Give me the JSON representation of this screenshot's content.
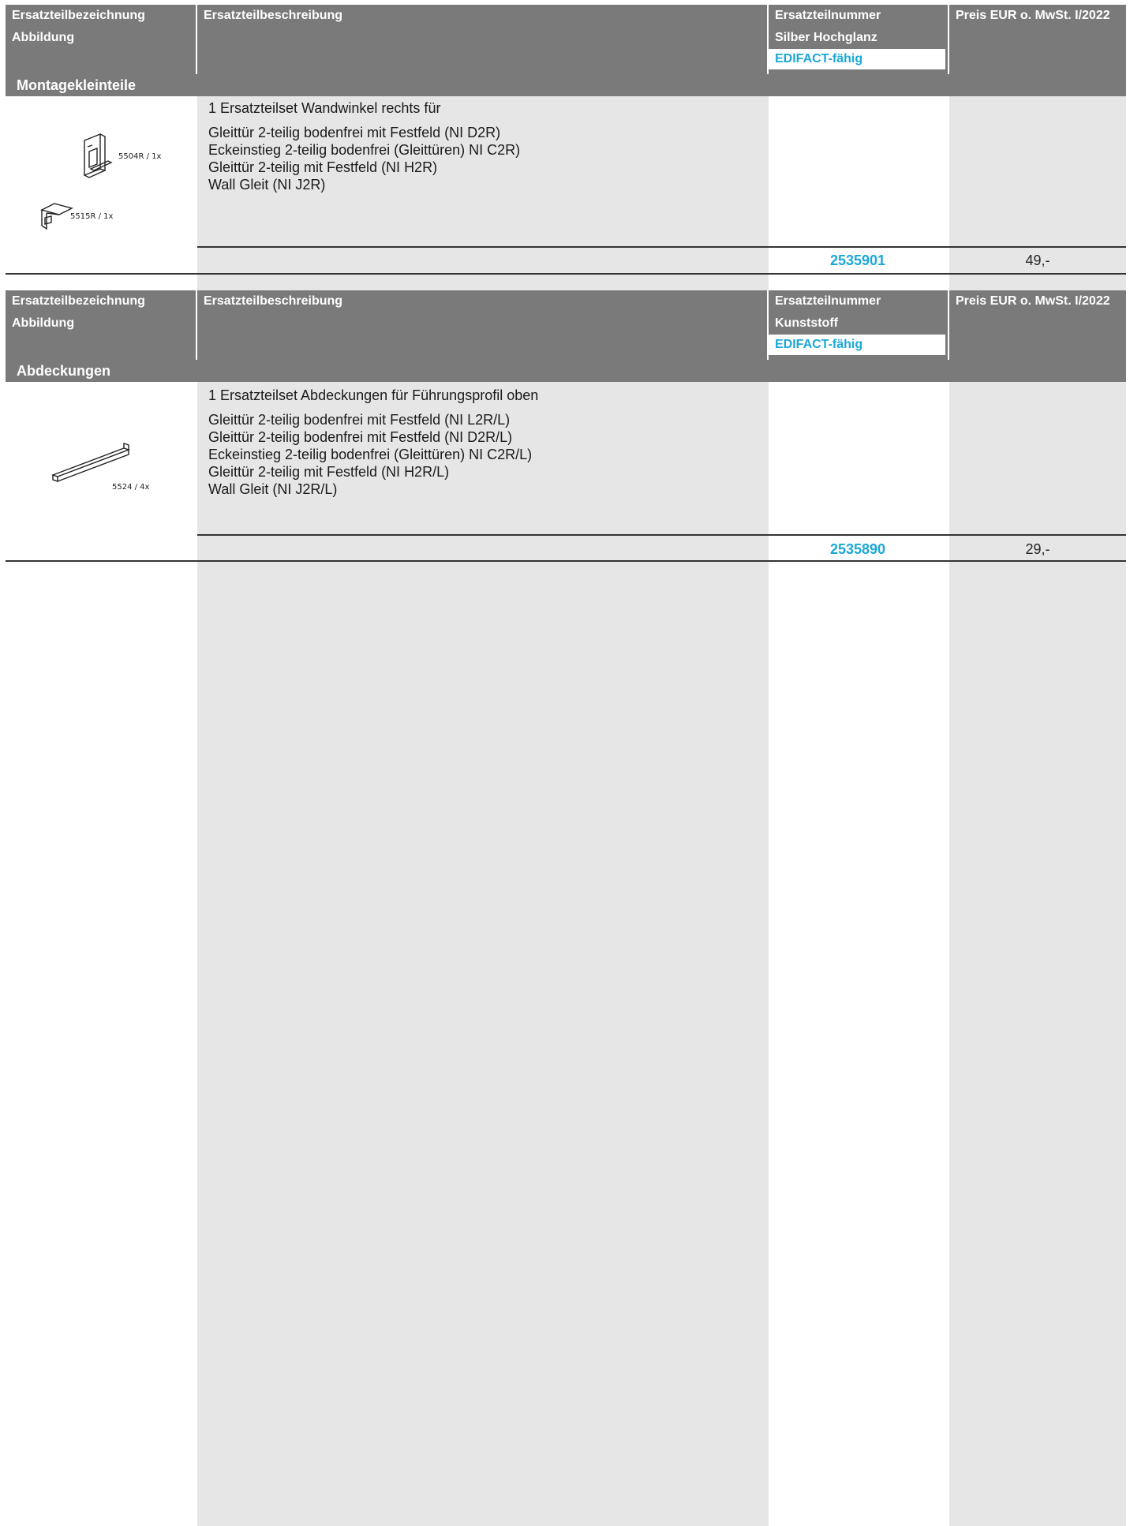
{
  "header": {
    "col1_line1": "Ersatzteilbezeichnung",
    "col1_line2": "Abbildung",
    "col2": "Ersatzteilbeschreibung",
    "col3_line1": "Ersatzteilnummer",
    "col3_edifact": "EDIFACT-fähig",
    "col4": "Preis EUR o. MwSt. I/2022"
  },
  "sections": [
    {
      "material": "Silber Hochglanz",
      "title": "Montagekleinteile",
      "description_title": "1 Ersatzteilset Wandwinkel rechts für",
      "description_items": [
        "Gleittür 2-teilig bodenfrei mit Festfeld (NI D2R)",
        "Eckeinstieg 2-teilig bodenfrei (Gleittüren) NI C2R)",
        "Gleittür 2-teilig mit Festfeld (NI H2R)",
        "Wall Gleit (NI J2R)"
      ],
      "image_labels": [
        "5504R / 1x",
        "5515R / 1x"
      ],
      "part_number": "2535901",
      "price": "49,-"
    },
    {
      "material": "Kunststoff",
      "title": "Abdeckungen",
      "description_title": "1 Ersatzteilset Abdeckungen für Führungsprofil oben",
      "description_items": [
        "Gleittür 2-teilig bodenfrei mit Festfeld (NI L2R/L)",
        "Gleittür 2-teilig bodenfrei mit Festfeld (NI D2R/L)",
        "Eckeinstieg 2-teilig bodenfrei (Gleittüren) NI C2R/L)",
        "Gleittür 2-teilig mit Festfeld (NI H2R/L)",
        "Wall Gleit (NI J2R/L)"
      ],
      "image_labels": [
        "5524 / 4x"
      ],
      "part_number": "2535890",
      "price": "29,-"
    }
  ],
  "colors": {
    "header_gray": "#7a7a7a",
    "band_gray": "#e6e6e6",
    "accent_blue": "#1aa8d8"
  }
}
